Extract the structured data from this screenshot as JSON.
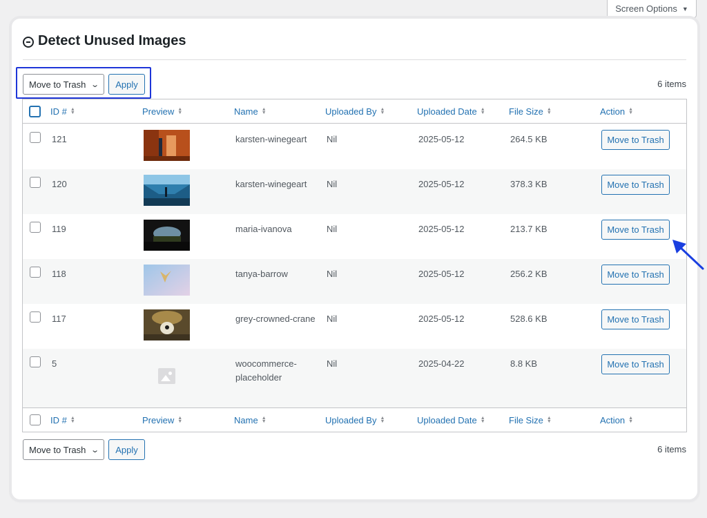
{
  "screen_options": {
    "label": "Screen Options",
    "caret": "▼"
  },
  "page": {
    "title": "Detect Unused Images"
  },
  "bulk_actions": {
    "selected": "Move to Trash",
    "apply_label": "Apply",
    "items_count": "6 items"
  },
  "columns": [
    "ID #",
    "Preview",
    "Name",
    "Uploaded By",
    "Uploaded Date",
    "File Size",
    "Action"
  ],
  "rows": [
    {
      "id": "121",
      "name": "karsten-winegeart",
      "name2": "",
      "uploaded_by": "Nil",
      "date": "2025-05-12",
      "size": "264.5 KB",
      "action": "Move to Trash",
      "preview": "orange-room"
    },
    {
      "id": "120",
      "name": "karsten-winegeart",
      "name2": "",
      "uploaded_by": "Nil",
      "date": "2025-05-12",
      "size": "378.3 KB",
      "action": "Move to Trash",
      "preview": "blue-corridor"
    },
    {
      "id": "119",
      "name": "maria-ivanova",
      "name2": "",
      "uploaded_by": "Nil",
      "date": "2025-05-12",
      "size": "213.7 KB",
      "action": "Move to Trash",
      "preview": "dark-window"
    },
    {
      "id": "118",
      "name": "tanya-barrow",
      "name2": "",
      "uploaded_by": "Nil",
      "date": "2025-05-12",
      "size": "256.2 KB",
      "action": "Move to Trash",
      "preview": "sky-bird"
    },
    {
      "id": "117",
      "name": "grey-crowned-crane",
      "name2": "",
      "uploaded_by": "Nil",
      "date": "2025-05-12",
      "size": "528.6 KB",
      "action": "Move to Trash",
      "preview": "crane"
    },
    {
      "id": "5",
      "name": "woocommerce-",
      "name2": "placeholder",
      "uploaded_by": "Nil",
      "date": "2025-04-22",
      "size": "8.8 KB",
      "action": "Move to Trash",
      "preview": "placeholder"
    }
  ],
  "colors": {
    "accent": "#2271b1",
    "highlight": "#1d35d8",
    "arrow": "#1a3fe0"
  }
}
